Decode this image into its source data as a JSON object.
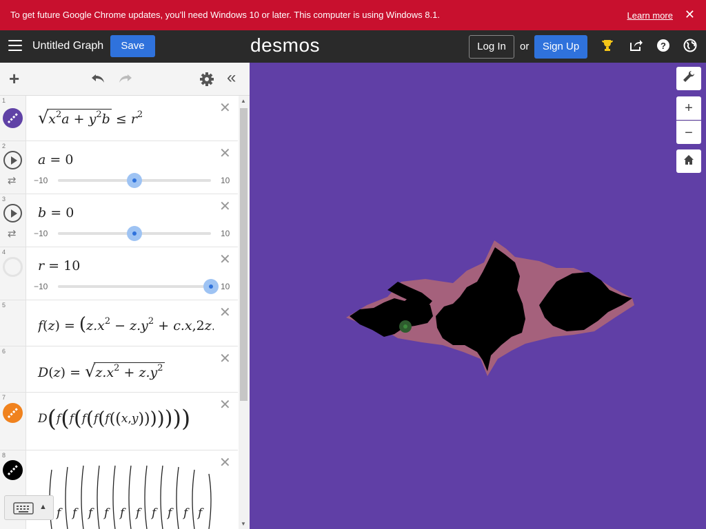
{
  "banner": {
    "message": "To get future Google Chrome updates, you'll need Windows 10 or later. This computer is using Windows 8.1.",
    "link": "Learn more",
    "close": "✕"
  },
  "topbar": {
    "graph_title": "Untitled Graph",
    "save_label": "Save",
    "logo": "desmos",
    "login_label": "Log In",
    "or_label": "or",
    "signup_label": "Sign Up"
  },
  "expressions": [
    {
      "num": "1",
      "color": "#6042a6"
    },
    {
      "num": "2",
      "var": "a",
      "value": "0",
      "min": "−10",
      "max": "10",
      "fraction": 0.5
    },
    {
      "num": "3",
      "var": "b",
      "value": "0",
      "min": "−10",
      "max": "10",
      "fraction": 0.5
    },
    {
      "num": "4",
      "var": "r",
      "value": "10",
      "min": "−10",
      "max": "10",
      "fraction": 1.0
    },
    {
      "num": "5"
    },
    {
      "num": "6"
    },
    {
      "num": "7",
      "color": "#f0821e"
    },
    {
      "num": "8",
      "color": "#000000"
    }
  ],
  "graph": {
    "background": "#603fa6",
    "fill_color": "#a5617c",
    "fractal_color": "#000000",
    "point_color": "#2e5b2e"
  }
}
